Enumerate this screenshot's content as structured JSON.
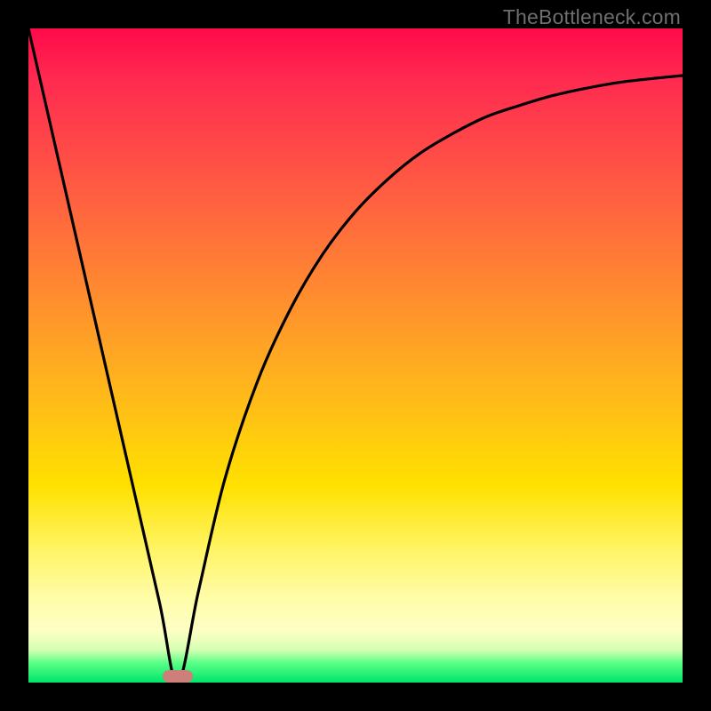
{
  "watermark": "TheBottleneck.com",
  "chart_data": {
    "type": "line",
    "title": "",
    "xlabel": "",
    "ylabel": "",
    "xlim": [
      0,
      1
    ],
    "ylim": [
      0,
      1
    ],
    "series": [
      {
        "name": "bottleneck-curve",
        "x": [
          0.0,
          0.05,
          0.1,
          0.15,
          0.2,
          0.228,
          0.26,
          0.3,
          0.35,
          0.4,
          0.45,
          0.5,
          0.55,
          0.6,
          0.65,
          0.7,
          0.75,
          0.8,
          0.85,
          0.9,
          0.95,
          1.0
        ],
        "y": [
          1.0,
          0.781,
          0.562,
          0.343,
          0.124,
          0.0,
          0.14,
          0.31,
          0.46,
          0.57,
          0.655,
          0.72,
          0.77,
          0.81,
          0.84,
          0.865,
          0.882,
          0.897,
          0.908,
          0.917,
          0.923,
          0.928
        ]
      }
    ],
    "marker": {
      "x": 0.228,
      "y": 0.01
    },
    "colors": {
      "curve": "#000000",
      "marker": "#cc8079",
      "gradient_top": "#ff0a4a",
      "gradient_bottom": "#00e46a"
    }
  }
}
